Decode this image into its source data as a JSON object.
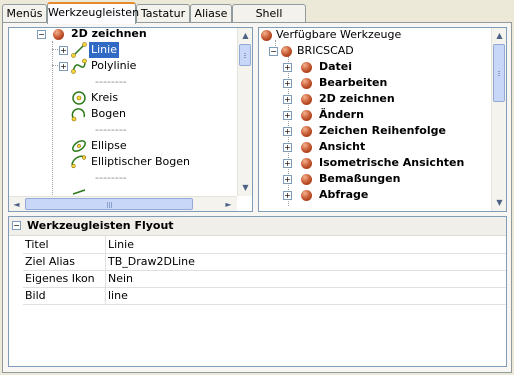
{
  "tabs": [
    "Menüs",
    "Werkzeugleisten",
    "Tastatur",
    "Aliase",
    "Shell Befehle"
  ],
  "active_tab": "Werkzeugleisten",
  "left_tree": {
    "root_label": "2D zeichnen",
    "items": [
      {
        "label": "Linie",
        "icon": "line-tool-icon",
        "selected": true,
        "expandable": true
      },
      {
        "label": "Polylinie",
        "icon": "polyline-tool-icon",
        "expandable": true
      },
      {
        "label": "--------",
        "separator": true
      },
      {
        "label": "Kreis",
        "icon": "circle-tool-icon"
      },
      {
        "label": "Bogen",
        "icon": "arc-tool-icon"
      },
      {
        "label": "--------",
        "separator": true
      },
      {
        "label": "Ellipse",
        "icon": "ellipse-tool-icon"
      },
      {
        "label": "Elliptischer Bogen",
        "icon": "elliptical-arc-tool-icon"
      },
      {
        "label": "--------",
        "separator": true
      }
    ]
  },
  "right_tree": {
    "header": "Verfügbare Werkzeuge",
    "root_label": "BRICSCAD",
    "items": [
      "Datei",
      "Bearbeiten",
      "2D zeichnen",
      "Ändern",
      "Zeichen Reihenfolge",
      "Ansicht",
      "Isometrische Ansichten",
      "Bemaßungen",
      "Abfrage"
    ]
  },
  "properties": {
    "section_title": "Werkzeugleisten Flyout",
    "rows": [
      {
        "key": "Titel",
        "value": "Linie"
      },
      {
        "key": "Ziel Alias",
        "value": "TB_Draw2DLine"
      },
      {
        "key": "Eigenes Ikon",
        "value": "Nein"
      },
      {
        "key": "Bild",
        "value": "line"
      }
    ]
  },
  "colors": {
    "selection": "#316ac5",
    "tab_accent": "#e68b2c",
    "border": "#7f9db9",
    "node_ball": "#c1502a"
  }
}
